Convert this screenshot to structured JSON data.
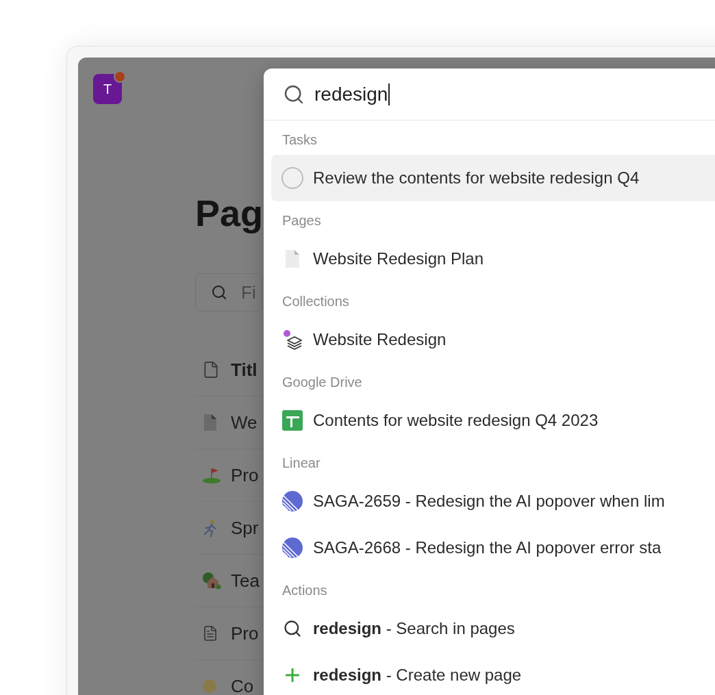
{
  "app": {
    "avatar": {
      "letter": "T",
      "notification": true
    },
    "title": "Pag",
    "filter": {
      "placeholder": "Fi"
    },
    "rows": [
      {
        "kind": "header",
        "label": "Titl"
      },
      {
        "kind": "page",
        "label": "We"
      },
      {
        "kind": "flag",
        "label": "Pro"
      },
      {
        "kind": "runner",
        "label": "Spr"
      },
      {
        "kind": "house",
        "label": "Tea"
      },
      {
        "kind": "doc",
        "label": "Pro"
      },
      {
        "kind": "bulb",
        "label": "Co"
      }
    ]
  },
  "palette": {
    "query": "redesign",
    "sections": [
      {
        "title": "Tasks",
        "items": [
          {
            "kind": "task",
            "label": "Review the contents for website redesign Q4",
            "checked": false,
            "selected": true
          }
        ]
      },
      {
        "title": "Pages",
        "items": [
          {
            "kind": "page",
            "label": "Website Redesign Plan",
            "selected": false
          }
        ]
      },
      {
        "title": "Collections",
        "items": [
          {
            "kind": "collection",
            "label": "Website Redesign",
            "selected": false
          }
        ]
      },
      {
        "title": "Google Drive",
        "items": [
          {
            "kind": "sheet",
            "label": "Contents for website redesign Q4 2023",
            "selected": false
          }
        ]
      },
      {
        "title": "Linear",
        "items": [
          {
            "kind": "issue",
            "label": "SAGA-2659 - Redesign the AI popover when lim",
            "selected": false
          },
          {
            "kind": "issue",
            "label": "SAGA-2668 - Redesign the AI popover error sta",
            "selected": false
          }
        ]
      },
      {
        "title": "Actions",
        "items": [
          {
            "kind": "search",
            "label": "**redesign** - Search in pages",
            "selected": false
          },
          {
            "kind": "create",
            "label": "**redesign** - Create new page",
            "selected": false
          }
        ]
      }
    ]
  }
}
